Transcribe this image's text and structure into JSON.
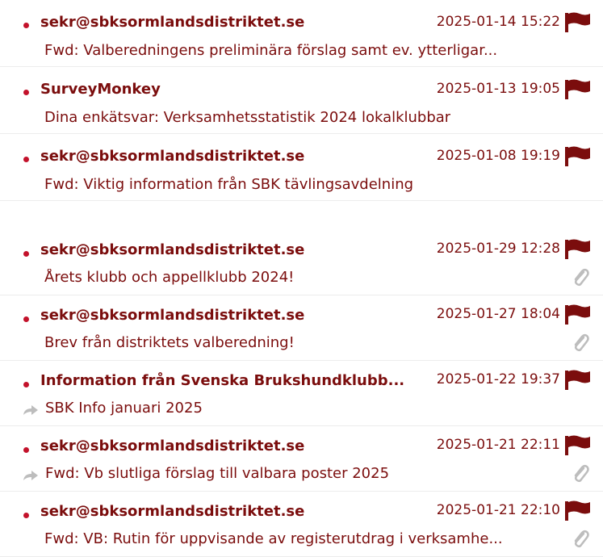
{
  "colors": {
    "accent": "#7b0d0d",
    "unread_dot": "#c3122b",
    "divider": "#ececec",
    "icon_grey": "#bdbdbd"
  },
  "icons": {
    "flag": "flag-icon",
    "attachment": "paperclip-icon",
    "forwarded": "forward-arrow-icon",
    "unread": "unread-dot-icon"
  },
  "messages_group_a": [
    {
      "sender": "sekr@sbksormlandsdistriktet.se",
      "date": "2025-01-14 15:22",
      "subject": "Fwd: Valberedningens preliminära förslag samt ev. ytterligar..."
    },
    {
      "sender": "SurveyMonkey",
      "date": "2025-01-13 19:05",
      "subject": "Dina enkätsvar: Verksamhetsstatistik 2024 lokalklubbar"
    },
    {
      "sender": "sekr@sbksormlandsdistriktet.se",
      "date": "2025-01-08 19:19",
      "subject": "Fwd: Viktig information från SBK tävlingsavdelning"
    }
  ],
  "messages_group_b": [
    {
      "sender": "sekr@sbksormlandsdistriktet.se",
      "date": "2025-01-29 12:28",
      "subject": "Årets klubb och appellklubb 2024!"
    },
    {
      "sender": "sekr@sbksormlandsdistriktet.se",
      "date": "2025-01-27 18:04",
      "subject": "Brev från distriktets valberedning!"
    },
    {
      "sender": "Information från Svenska Brukshundklubb...",
      "date": "2025-01-22 19:37",
      "subject": "SBK Info januari 2025"
    },
    {
      "sender": "sekr@sbksormlandsdistriktet.se",
      "date": "2025-01-21 22:11",
      "subject": "Fwd: Vb slutliga förslag till valbara poster 2025"
    },
    {
      "sender": "sekr@sbksormlandsdistriktet.se",
      "date": "2025-01-21 22:10",
      "subject": "Fwd: VB: Rutin för uppvisande av registerutdrag i verksamhe..."
    }
  ]
}
